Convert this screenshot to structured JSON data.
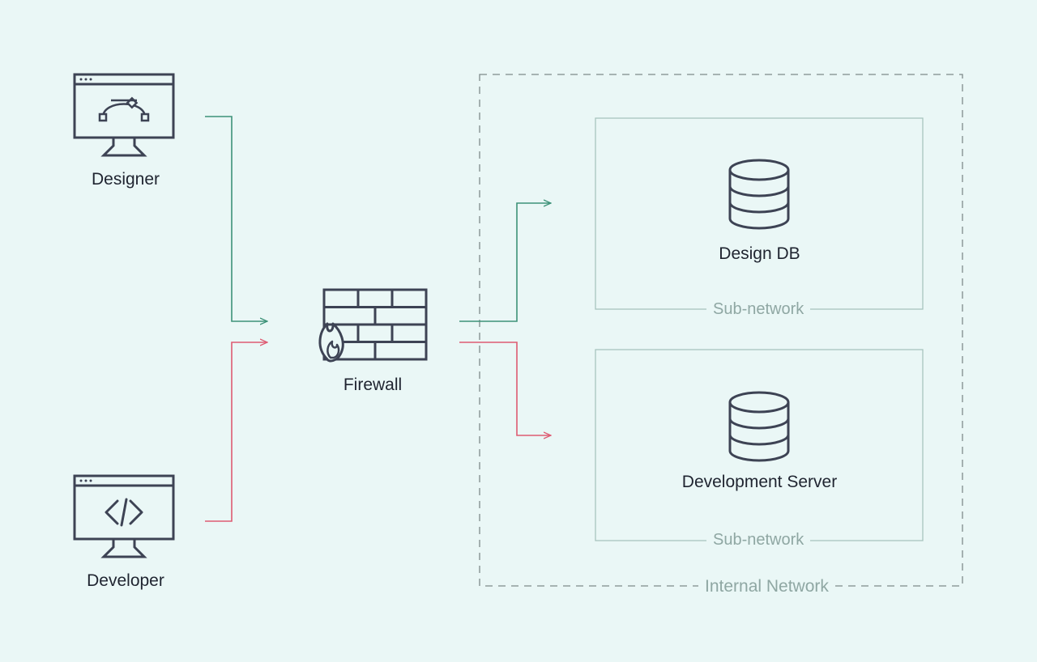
{
  "nodes": {
    "designer": {
      "label": "Designer"
    },
    "developer": {
      "label": "Developer"
    },
    "firewall": {
      "label": "Firewall"
    },
    "design_db": {
      "label": "Design DB"
    },
    "dev_server": {
      "label": "Development  Server"
    }
  },
  "frames": {
    "internal": {
      "label": "Internal Network"
    },
    "sub1": {
      "label": "Sub-network"
    },
    "sub2": {
      "label": "Sub-network"
    }
  },
  "colors": {
    "stroke": "#3d4354",
    "green": "#3d9278",
    "red": "#de5b72",
    "frame": "#7e8a8a",
    "subframe": "#8fa7a3",
    "subframe_border": "#a8c4be"
  }
}
